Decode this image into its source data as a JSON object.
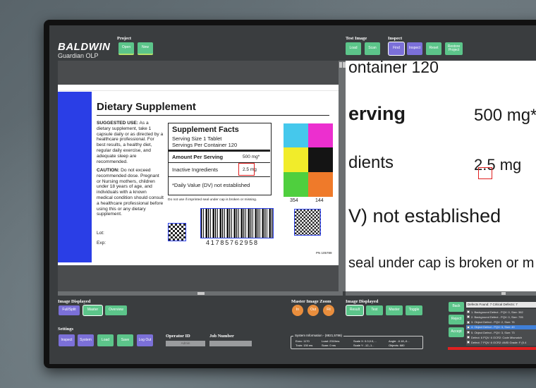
{
  "brand": {
    "name": "BALDWIN",
    "product": "Guardian OLP"
  },
  "project": {
    "label": "Project",
    "open": "Open",
    "new": "New"
  },
  "test_image": {
    "label": "Test Image",
    "load": "Load",
    "scan": "Scan"
  },
  "inspect": {
    "label": "Inspect",
    "find": "Find",
    "inspect": "Inspect",
    "reset": "Reset",
    "restore": "Restore Project"
  },
  "document": {
    "title": "Dietary Supplement",
    "suggested_head": "SUGGESTED USE:",
    "suggested_body": "As a dietary supplement, take 1 capsule daily or as directed by a healthcare professional. For best results, a healthy diet, regular daily exercise, and adequate sleep are recommended.",
    "caution_head": "CAUTION:",
    "caution_body": "Do not exceed recommended dose. Pregnant or Nursing mothers, children under 18 years of age, and individuals with a known medical condition should consult a healthcare professional before using this or any dietary supplement.",
    "lot": "Lot:",
    "exp": "Exp:",
    "facts_title": "Supplement Facts",
    "serving_size": "Serving Size 1 Tablet",
    "servings_per": "Servings Per Container 120",
    "amount_label": "Amount Per Serving",
    "amount_value": "500 mg*",
    "inactive_label": "Inactive Ingredients",
    "inactive_value": "2.5 mg",
    "dv_note": "*Daily Value (DV) not established",
    "seal_note": "Do not use if imprinted seal under cap is broken or missing.",
    "barcode_number": "41785762958",
    "swatch_a": "354",
    "swatch_b": "144",
    "pn": "PN 105789"
  },
  "zoom_text": {
    "line1": "ontainer 120",
    "line2_a": "erving",
    "line2_b": "500 mg*",
    "line3_a": "dients",
    "line3_b": "2.5 mg",
    "line4": "V) not established",
    "line5": "seal under cap is broken or m"
  },
  "image_displayed_left": {
    "label": "Image Displayed",
    "full_split": "Full/Split",
    "master": "Master",
    "overview": "Overview"
  },
  "master_zoom": {
    "label": "Master Image Zoom",
    "in": "In",
    "out": "Out",
    "fit": "Fit"
  },
  "image_displayed_right": {
    "label": "Image Displayed",
    "result": "Result",
    "test": "Test",
    "master": "Master",
    "toggle": "Toggle"
  },
  "settings": {
    "label": "Settings",
    "inspect": "Inspect",
    "system": "System",
    "load": "Load",
    "save": "Save",
    "logout": "Log Out"
  },
  "operator": {
    "label": "Operator ID",
    "value": "Admin"
  },
  "job": {
    "label": "Job Number",
    "value": ""
  },
  "system_info": {
    "label": "System Information - (8821,5786)",
    "exec": "Exec: 1170",
    "train": "Train: 130 ms",
    "load": "Load: 2310ms",
    "scan": "Scan: 0 ms",
    "scale_x": "Scale X: 0.0,0.0,...",
    "scale_y": "Scale Y: -12,-1...",
    "angle": "Angle: -0.18,-0...",
    "objects": "Objects: 680"
  },
  "defect_actions": {
    "back": "Back",
    "reject": "Reject",
    "accept": "Accept"
  },
  "defects": {
    "summary": "Defects Found: 7  Critical Defects: 7",
    "items": [
      "1. Background Defect - PQV: 0, Size: 382",
      "2. Background Defect - PQV: 0, Size: 795",
      "3. Object Defect - PQV: 2, Size: 76",
      "4. Object Defect - PQV: 3, Size: 49",
      "5. Object Defect - PQV: 3, Size: 73",
      "Defect: 6 PQV: 6 OCR2: Code Mismatch",
      "Defect: 7 PQV: 6 OCR2: ANSI Grade: F (0.4"
    ],
    "selected_index": 3
  },
  "colors": {
    "accent_green": "#5cc58a",
    "accent_purple": "#7b70d8",
    "accent_orange": "#e98e3d",
    "defect_red": "#e02020",
    "label_blue": "#2a3ee6"
  }
}
